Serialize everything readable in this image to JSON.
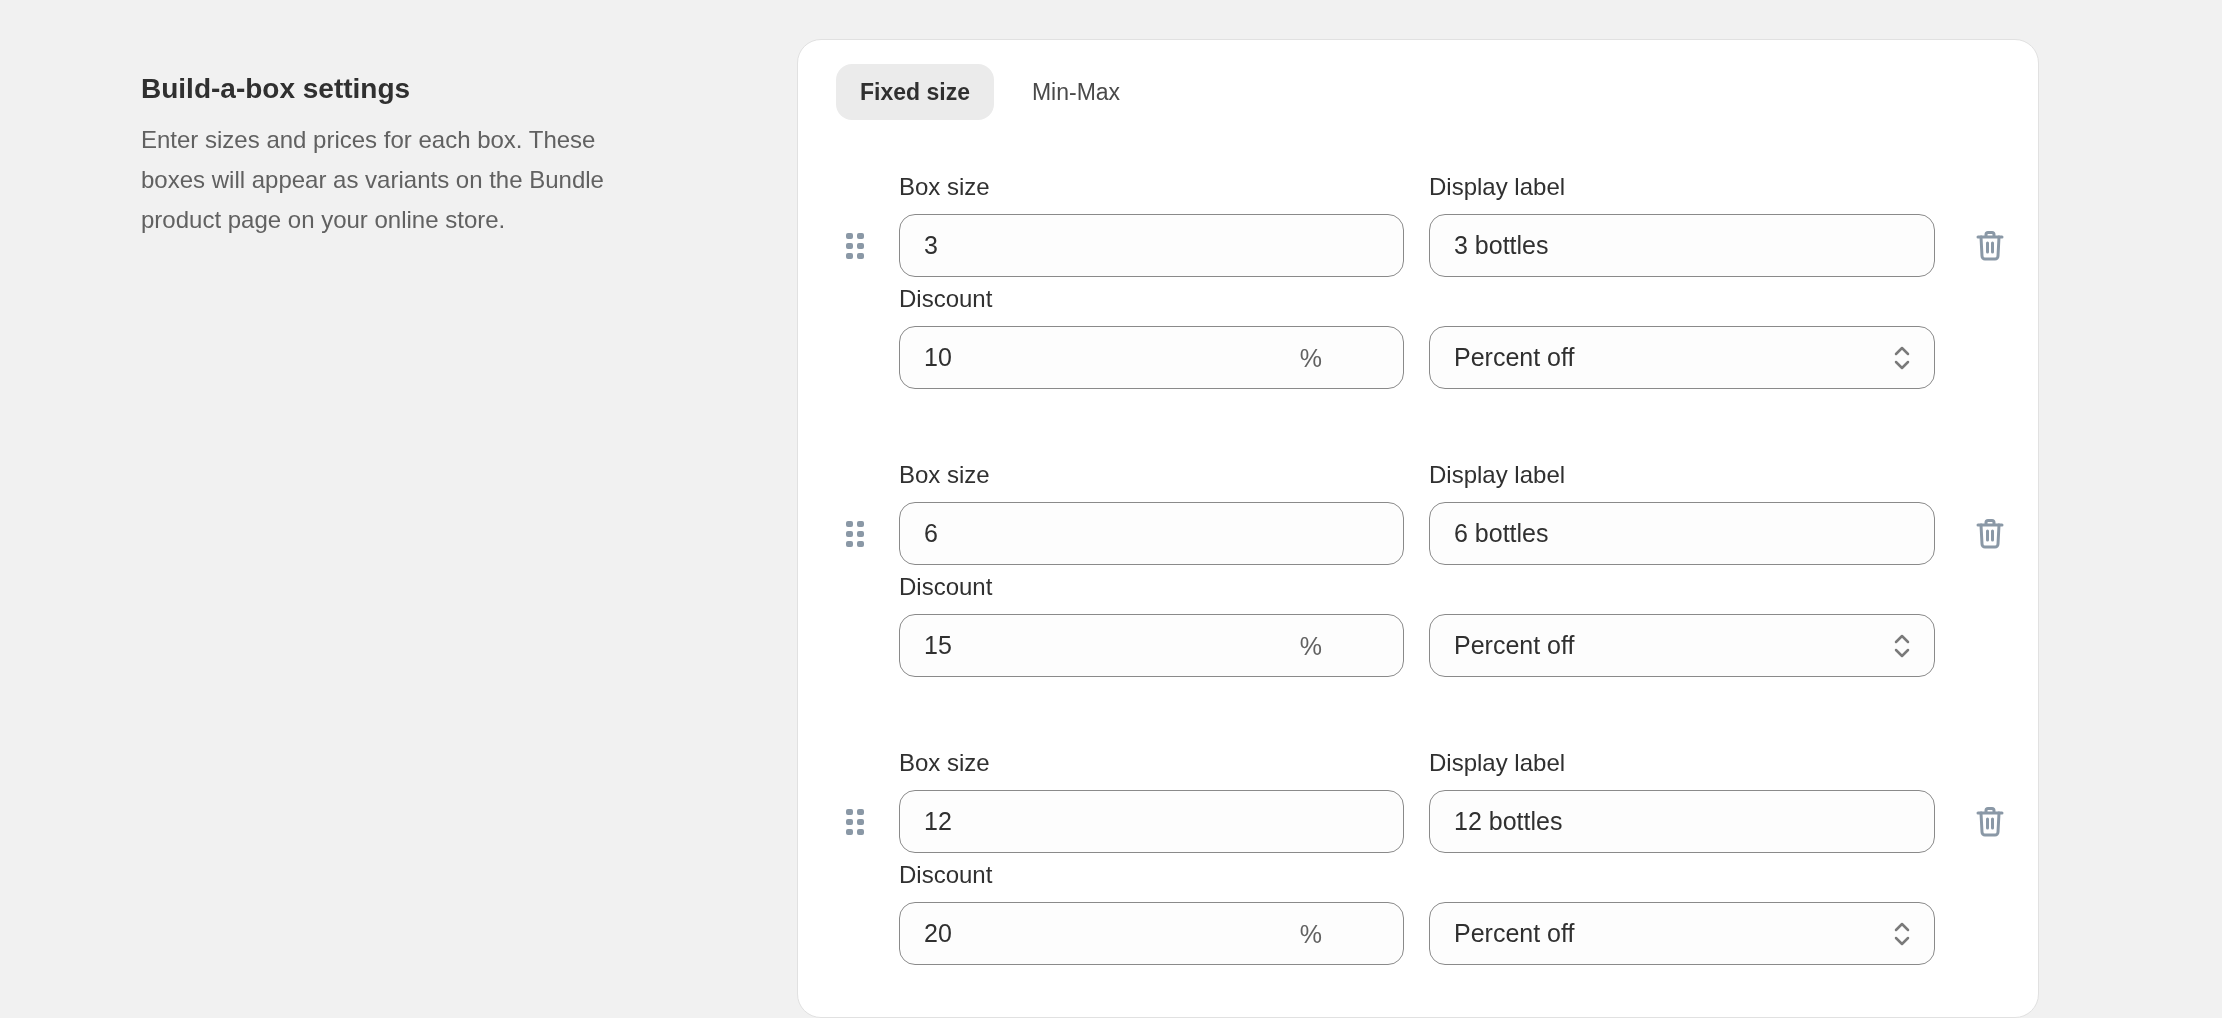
{
  "section": {
    "title": "Build-a-box settings",
    "description": "Enter sizes and prices for each box. These boxes will appear as variants on the Bundle product page on your online store."
  },
  "tabs": [
    {
      "label": "Fixed size",
      "selected": true
    },
    {
      "label": "Min-Max",
      "selected": false
    }
  ],
  "boxes": [
    {
      "box_size_label": "Box size",
      "box_size": "3",
      "display_label_label": "Display label",
      "display_label": "3 bottles",
      "discount_label": "Discount",
      "discount": "10",
      "discount_suffix": "%",
      "discount_type": "Percent off"
    },
    {
      "box_size_label": "Box size",
      "box_size": "6",
      "display_label_label": "Display label",
      "display_label": "6 bottles",
      "discount_label": "Discount",
      "discount": "15",
      "discount_suffix": "%",
      "discount_type": "Percent off"
    },
    {
      "box_size_label": "Box size",
      "box_size": "12",
      "display_label_label": "Display label",
      "display_label": "12 bottles",
      "discount_label": "Discount",
      "discount": "20",
      "discount_suffix": "%",
      "discount_type": "Percent off"
    }
  ]
}
